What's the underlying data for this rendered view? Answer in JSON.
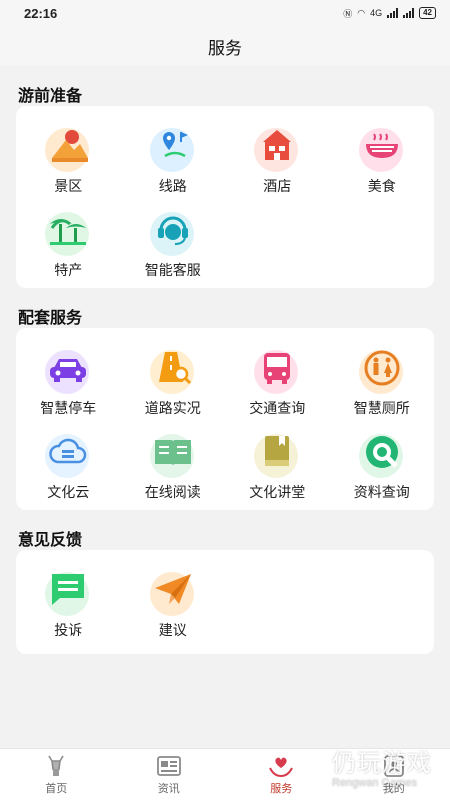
{
  "status_bar": {
    "time": "22:16",
    "battery": "42",
    "network": "4G"
  },
  "header": {
    "title": "服务"
  },
  "sections": [
    {
      "title": "游前准备",
      "items": [
        {
          "label": "景区",
          "icon": "scenic-area-icon"
        },
        {
          "label": "线路",
          "icon": "route-icon"
        },
        {
          "label": "酒店",
          "icon": "hotel-icon"
        },
        {
          "label": "美食",
          "icon": "food-icon"
        },
        {
          "label": "特产",
          "icon": "specialty-icon"
        },
        {
          "label": "智能客服",
          "icon": "customer-service-icon"
        }
      ]
    },
    {
      "title": "配套服务",
      "items": [
        {
          "label": "智慧停车",
          "icon": "parking-icon"
        },
        {
          "label": "道路实况",
          "icon": "road-conditions-icon"
        },
        {
          "label": "交通查询",
          "icon": "bus-icon"
        },
        {
          "label": "智慧厕所",
          "icon": "toilet-icon"
        },
        {
          "label": "文化云",
          "icon": "cloud-icon"
        },
        {
          "label": "在线阅读",
          "icon": "book-icon"
        },
        {
          "label": "文化讲堂",
          "icon": "lecture-icon"
        },
        {
          "label": "资料查询",
          "icon": "search-icon"
        }
      ]
    },
    {
      "title": "意见反馈",
      "items": [
        {
          "label": "投诉",
          "icon": "complaint-icon"
        },
        {
          "label": "建议",
          "icon": "paper-plane-icon"
        }
      ]
    }
  ],
  "tabbar": [
    {
      "label": "首页",
      "icon": "deer-icon",
      "active": false
    },
    {
      "label": "资讯",
      "icon": "newspaper-icon",
      "active": false
    },
    {
      "label": "服务",
      "icon": "heart-hands-icon",
      "active": true
    },
    {
      "label": "我的",
      "icon": "profile-icon",
      "active": false
    }
  ],
  "watermark": {
    "cn": "仍玩游戏",
    "en": "Rengwan Games"
  },
  "colors": {
    "accent": "#c0392b",
    "background": "#f2f2f2",
    "card": "#ffffff"
  }
}
